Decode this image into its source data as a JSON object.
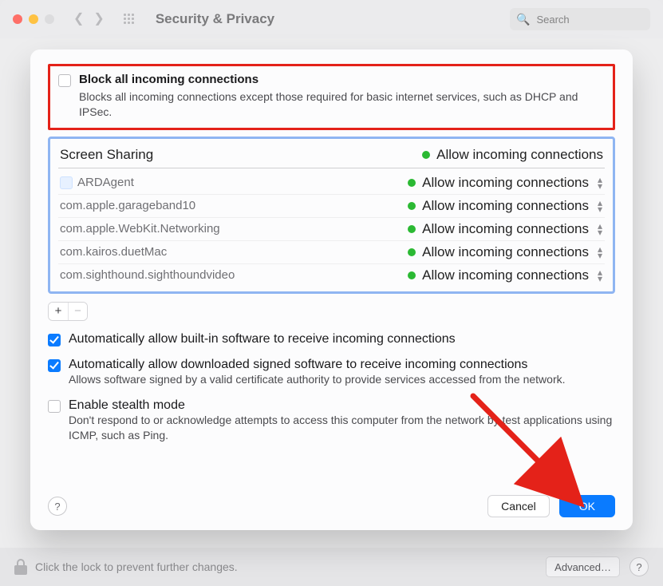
{
  "titlebar": {
    "title": "Security & Privacy",
    "search_placeholder": "Search"
  },
  "dialog": {
    "block_all": {
      "label": "Block all incoming connections",
      "description": "Blocks all incoming connections except those required for basic internet services, such as DHCP and IPSec.",
      "checked": false
    },
    "app_list": {
      "header_name": "Screen Sharing",
      "header_status": "Allow incoming connections",
      "rows": [
        {
          "name": "ARDAgent",
          "status": "Allow incoming connections",
          "has_icon": true
        },
        {
          "name": "com.apple.garageband10",
          "status": "Allow incoming connections",
          "has_icon": false
        },
        {
          "name": "com.apple.WebKit.Networking",
          "status": "Allow incoming connections",
          "has_icon": false
        },
        {
          "name": "com.kairos.duetMac",
          "status": "Allow incoming connections",
          "has_icon": false
        },
        {
          "name": "com.sighthound.sighthoundvideo",
          "status": "Allow incoming connections",
          "has_icon": false
        }
      ],
      "add_label": "+",
      "remove_label": "−"
    },
    "auto_builtin": {
      "label": "Automatically allow built-in software to receive incoming connections",
      "checked": true
    },
    "auto_signed": {
      "label": "Automatically allow downloaded signed software to receive incoming connections",
      "description": "Allows software signed by a valid certificate authority to provide services accessed from the network.",
      "checked": true
    },
    "stealth": {
      "label": "Enable stealth mode",
      "description": "Don't respond to or acknowledge attempts to access this computer from the network by test applications using ICMP, such as Ping.",
      "checked": false
    },
    "buttons": {
      "cancel": "Cancel",
      "ok": "OK"
    },
    "help": "?"
  },
  "lockrow": {
    "text": "Click the lock to prevent further changes.",
    "advanced": "Advanced…",
    "help": "?"
  },
  "colors": {
    "accent": "#0a7bff",
    "status_green": "#2bb933",
    "highlight_red": "#e42219",
    "highlight_blue": "#8fb5f2"
  }
}
